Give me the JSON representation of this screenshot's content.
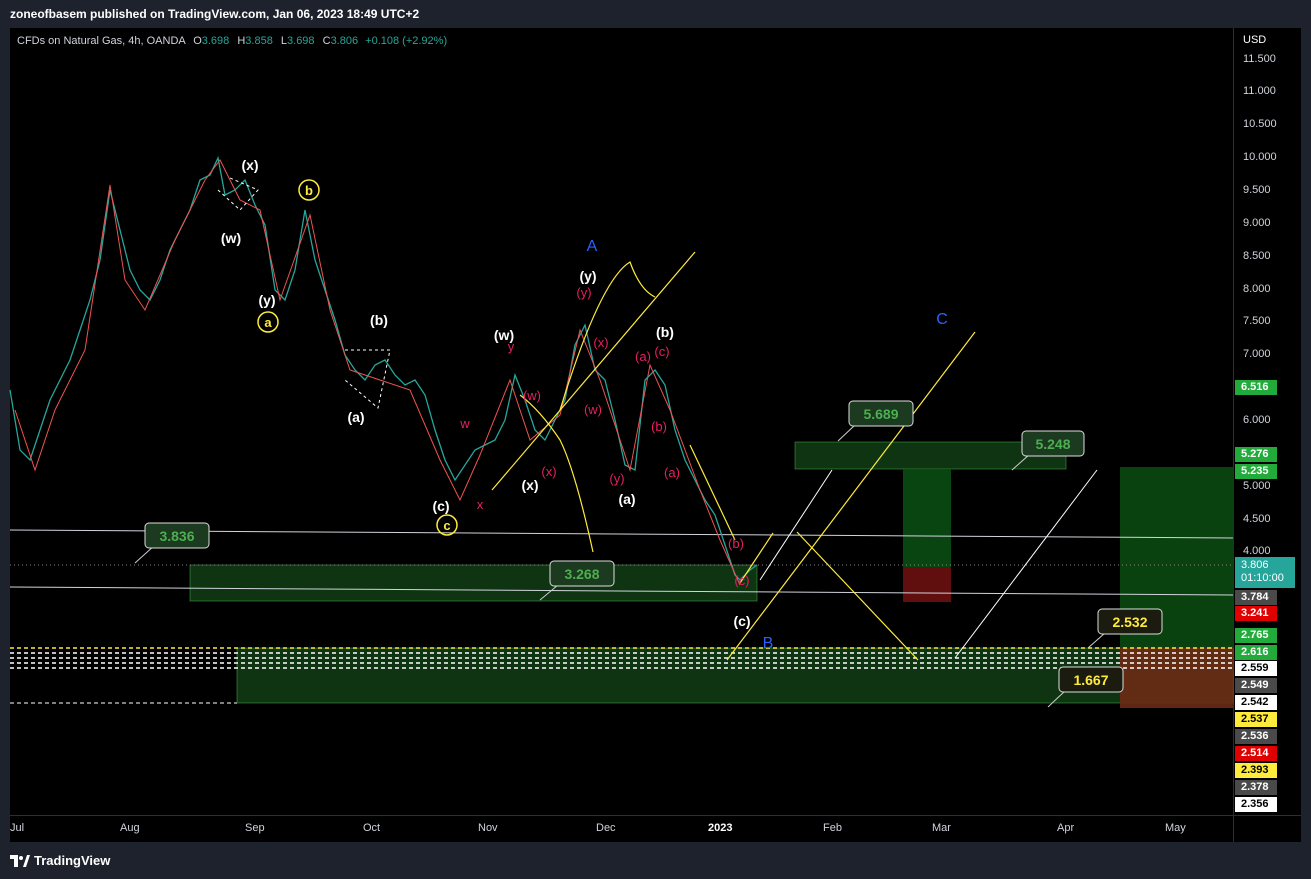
{
  "header": {
    "publisher_line": "zoneofbasem published on TradingView.com, Jan 06, 2023 18:49 UTC+2"
  },
  "legend": {
    "symbol": "CFDs on Natural Gas, 4h, OANDA",
    "open_label": "O",
    "open": "3.698",
    "high_label": "H",
    "high": "3.858",
    "low_label": "L",
    "low": "3.698",
    "close_label": "C",
    "close": "3.806",
    "change": "+0.108 (+2.92%)"
  },
  "price_axis": {
    "currency": "USD",
    "ticks": [
      "11.500",
      "11.000",
      "10.500",
      "10.000",
      "9.500",
      "9.000",
      "8.500",
      "8.000",
      "7.500",
      "7.000",
      "6.000",
      "5.000",
      "4.500",
      "4.000"
    ]
  },
  "current_price": {
    "value": "3.806",
    "countdown": "01:10:00"
  },
  "price_tags": [
    {
      "value": "6.516",
      "bg": "#22ab3a",
      "fg": "#ffffff"
    },
    {
      "value": "5.276",
      "bg": "#22ab3a",
      "fg": "#ffffff"
    },
    {
      "value": "5.235",
      "bg": "#22ab3a",
      "fg": "#ffffff"
    },
    {
      "value": "3.784",
      "bg": "#4a4a4a",
      "fg": "#ffffff"
    },
    {
      "value": "3.241",
      "bg": "#e00000",
      "fg": "#ffffff"
    },
    {
      "value": "2.765",
      "bg": "#22ab3a",
      "fg": "#ffffff"
    },
    {
      "value": "2.616",
      "bg": "#22ab3a",
      "fg": "#ffffff"
    },
    {
      "value": "2.559",
      "bg": "#ffffff",
      "fg": "#000000"
    },
    {
      "value": "2.549",
      "bg": "#4a4a4a",
      "fg": "#ffffff"
    },
    {
      "value": "2.542",
      "bg": "#ffffff",
      "fg": "#000000"
    },
    {
      "value": "2.537",
      "bg": "#ffeb3b",
      "fg": "#000000"
    },
    {
      "value": "2.536",
      "bg": "#4a4a4a",
      "fg": "#ffffff"
    },
    {
      "value": "2.514",
      "bg": "#e00000",
      "fg": "#ffffff"
    },
    {
      "value": "2.393",
      "bg": "#ffeb3b",
      "fg": "#000000"
    },
    {
      "value": "2.378",
      "bg": "#4a4a4a",
      "fg": "#ffffff"
    },
    {
      "value": "2.356",
      "bg": "#ffffff",
      "fg": "#000000"
    }
  ],
  "time_axis": [
    "Jul",
    "Aug",
    "Sep",
    "Oct",
    "Nov",
    "Dec",
    "2023",
    "Feb",
    "Mar",
    "Apr",
    "May"
  ],
  "callouts": {
    "c1": "3.836",
    "c2": "3.268",
    "c3": "5.689",
    "c4": "5.248",
    "c5": "2.532",
    "c6": "1.667"
  },
  "wave_labels": {
    "white": [
      "(x)",
      "(w)",
      "(y)",
      "(b)",
      "(a)",
      "(c)",
      "(w)",
      "(x)",
      "(y)",
      "(b)",
      "(a)",
      "(c)"
    ],
    "yellow_circled": [
      "b",
      "a",
      "c"
    ],
    "red": [
      "w",
      "x",
      "y",
      "(w)",
      "(x)",
      "(y)",
      "(x)",
      "(w)",
      "(y)",
      "(a)",
      "(c)",
      "(b)",
      "(a)",
      "(b)",
      "(c)"
    ],
    "blue": [
      "A",
      "B",
      "C"
    ]
  },
  "colors": {
    "bull": "#26a69a",
    "bear": "#ef5350",
    "zone": "#1b5e20",
    "yellow": "#ffeb3b",
    "wave_red": "#e91e63",
    "wave_blue": "#2962ff"
  },
  "footer": {
    "brand": "TradingView"
  }
}
